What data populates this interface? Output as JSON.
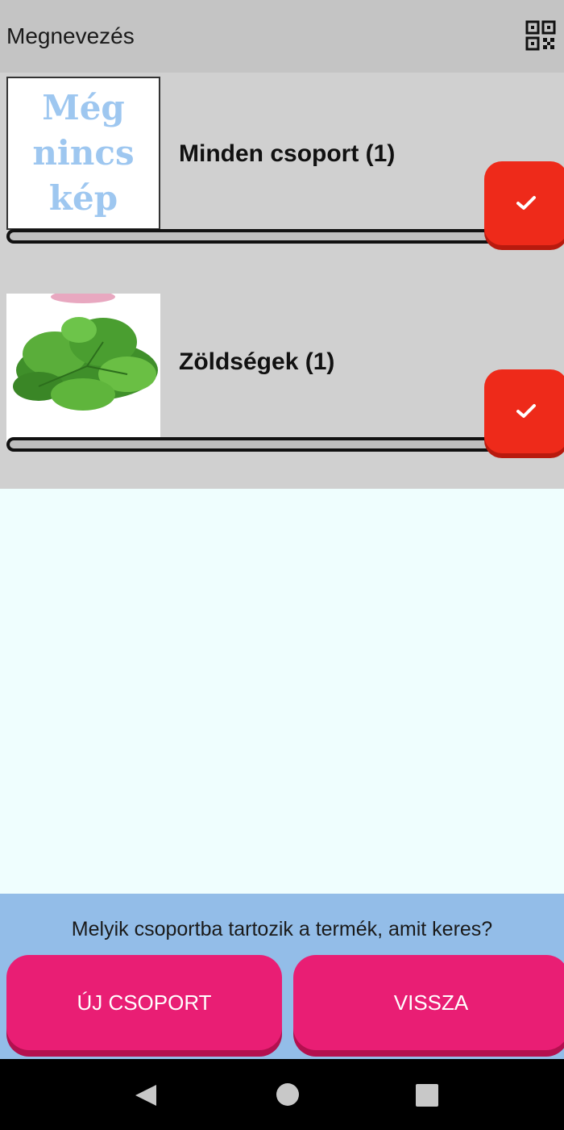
{
  "header": {
    "title": "Megnevezés",
    "qr_icon": "qr-code-icon"
  },
  "groups": [
    {
      "label": "Minden csoport (1)",
      "image": "no-image-placeholder",
      "placeholder_lines": [
        "Még",
        "nincs",
        "kép"
      ],
      "check_icon": "check-icon"
    },
    {
      "label": "Zöldségek (1)",
      "image": "spinach-leaves-photo",
      "check_icon": "check-icon"
    }
  ],
  "footer": {
    "question": "Melyik csoportba tartozik a termék, amit keres?",
    "new_group_label": "ÚJ CSOPORT",
    "back_label": "VISSZA"
  },
  "colors": {
    "header_bg": "#c4c4c4",
    "row_bg": "#d0d0d0",
    "check_red": "#ee2a1a",
    "pink": "#e91e74",
    "panel_blue": "#93bde8",
    "empty_bg": "#effefe"
  }
}
